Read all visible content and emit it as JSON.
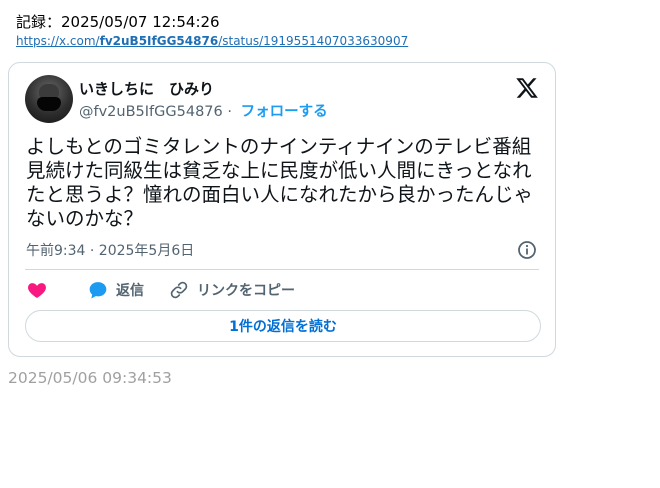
{
  "record": {
    "timestamp": "記録：2025/05/07 12:54:26",
    "url_prefix": "https://x.com/",
    "url_handle": "fv2uB5IfGG54876",
    "url_suffix": "/status/1919551407033630907"
  },
  "tweet": {
    "author_name": "いきしちに　ひみり",
    "author_handle": "@fv2uB5IfGG54876",
    "separator": " · ",
    "follow_label": "フォローする",
    "text": "よしもとのゴミタレントのナインティナインのテレビ番組見続けた同級生は貧乏な上に民度が低い人間にきっとなれたと思うよ？憧れの面白い人になれたから良かったんじゃないのかな？",
    "posted_time": "午前9:34 · 2025年5月6日",
    "actions": {
      "like_icon": "heart-icon",
      "reply_label": "返信",
      "copy_link_label": "リンクをコピー"
    },
    "read_replies_label": "1件の返信を読む",
    "brand_icon": "x-logo-icon",
    "accent_color": "#1d9bf0",
    "like_color": "#f91880"
  },
  "footer": {
    "timestamp": "2025/05/06 09:34:53"
  }
}
